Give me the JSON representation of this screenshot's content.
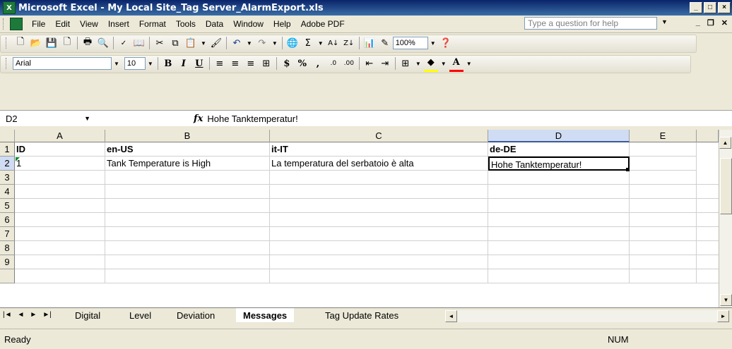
{
  "window": {
    "title": "Microsoft Excel - My Local Site_Tag Server_AlarmExport.xls"
  },
  "menu": {
    "items": [
      "File",
      "Edit",
      "View",
      "Insert",
      "Format",
      "Tools",
      "Data",
      "Window",
      "Help",
      "Adobe PDF"
    ],
    "help_placeholder": "Type a question for help"
  },
  "toolbar1": {
    "zoom": "100%"
  },
  "toolbar2": {
    "font": "Arial",
    "size": "10"
  },
  "formula_bar": {
    "name_box": "D2",
    "fx": "fx",
    "content": "Hohe Tanktemperatur!"
  },
  "grid": {
    "columns": [
      "A",
      "B",
      "C",
      "D",
      "E"
    ],
    "rows": [
      "1",
      "2",
      "3",
      "4",
      "5",
      "6",
      "7",
      "8",
      "9"
    ],
    "cells": {
      "A1": "ID",
      "B1": "en-US",
      "C1": "it-IT",
      "D1": "de-DE",
      "A2": "1",
      "B2": "Tank Temperature is High",
      "C2": "La temperatura del serbatoio è alta",
      "D2": "Hohe Tanktemperatur!"
    },
    "active_cell": "D2"
  },
  "sheets": {
    "tabs": [
      "Digital",
      "Level",
      "Deviation",
      "Messages",
      "Tag Update Rates"
    ],
    "active": "Messages"
  },
  "status": {
    "left": "Ready",
    "num": "NUM"
  }
}
